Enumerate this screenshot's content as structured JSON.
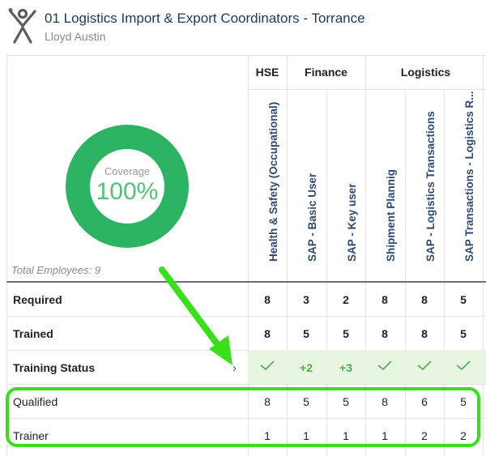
{
  "header": {
    "title": "01 Logistics Import & Export Coordinators - Torrance",
    "subtitle": "Lloyd Austin"
  },
  "coverage": {
    "label": "Coverage",
    "value": "100%",
    "total_employees": "Total Employees: 9",
    "color": "#2db463"
  },
  "groups": [
    "HSE",
    "Finance",
    "Logistics"
  ],
  "columns": [
    "Health & Safety (Occupational)",
    "SAP - Basic User",
    "SAP - Key user",
    "Shipment Plannig",
    "SAP - Logistics Transactions",
    "SAP Transactions - Logistics R..."
  ],
  "rows": {
    "required": {
      "label": "Required",
      "values": [
        "8",
        "3",
        "2",
        "8",
        "8",
        "5"
      ]
    },
    "trained": {
      "label": "Trained",
      "values": [
        "8",
        "5",
        "5",
        "8",
        "8",
        "5"
      ]
    },
    "training_status": {
      "label": "Training Status",
      "values": [
        "check",
        "+2",
        "+3",
        "check",
        "check",
        "check"
      ]
    },
    "qualified": {
      "label": "Qualified",
      "values": [
        "8",
        "5",
        "5",
        "8",
        "6",
        "5"
      ]
    },
    "trainer": {
      "label": "Trainer",
      "values": [
        "1",
        "1",
        "1",
        "1",
        "2",
        "2"
      ]
    }
  },
  "colors": {
    "status_bg": "#e8f6e1",
    "status_fg": "#4caf50",
    "highlight": "#38e01a",
    "title": "#1d3a5a"
  },
  "icons": {
    "logo": "person-x-logo-icon",
    "check": "check-icon",
    "chevron": "chevron-right-icon",
    "arrow": "annotation-arrow-icon"
  }
}
